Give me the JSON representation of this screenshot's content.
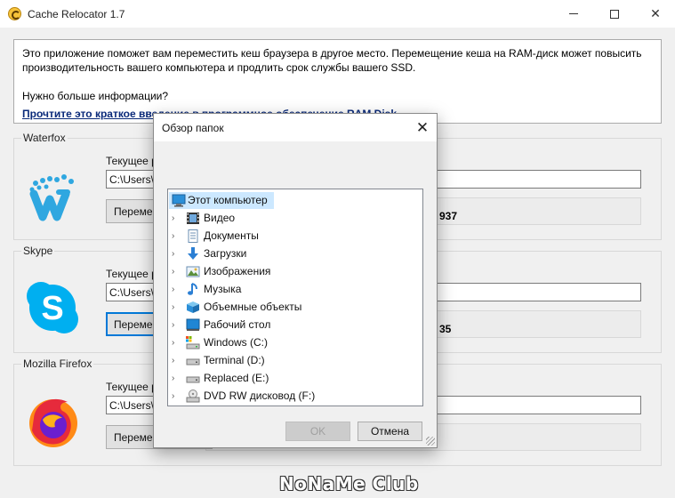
{
  "window": {
    "title": "Cache Relocator 1.7"
  },
  "info": {
    "line1": "Это приложение поможет вам переместить кеш браузера в другое место. Перемещение кеша на RAM-диск может повысить производительность вашего компьютера и продлить срок службы вашего SSD.",
    "line2": "Нужно больше информации?",
    "link": "Прочтите это краткое введение в программное обеспечение RAM Disk"
  },
  "groups": [
    {
      "title": "Waterfox",
      "label": "Текущее р",
      "path": "C:\\Users\\/",
      "button": "Перемес",
      "size": "937"
    },
    {
      "title": "Skype",
      "label": "Текущее р",
      "path": "C:\\Users\\/",
      "button": "Перемес",
      "size": "35"
    },
    {
      "title": "Mozilla Firefox",
      "label": "Текущее р",
      "path": "C:\\Users\\/",
      "button": "Перемес",
      "size": ""
    }
  ],
  "dialog": {
    "title": "Обзор папок",
    "root": "Этот компьютер",
    "items": [
      "Видео",
      "Документы",
      "Загрузки",
      "Изображения",
      "Музыка",
      "Объемные объекты",
      "Рабочий стол",
      "Windows (C:)",
      "Terminal (D:)",
      "Replaced (E:)",
      "DVD RW дисковод (F:)"
    ],
    "ok": "OK",
    "cancel": "Отмена"
  },
  "watermark": "NoNaMe Club",
  "colors": {
    "accent": "#0078d7",
    "selection": "#cce8ff",
    "link": "#0a2a7a"
  }
}
